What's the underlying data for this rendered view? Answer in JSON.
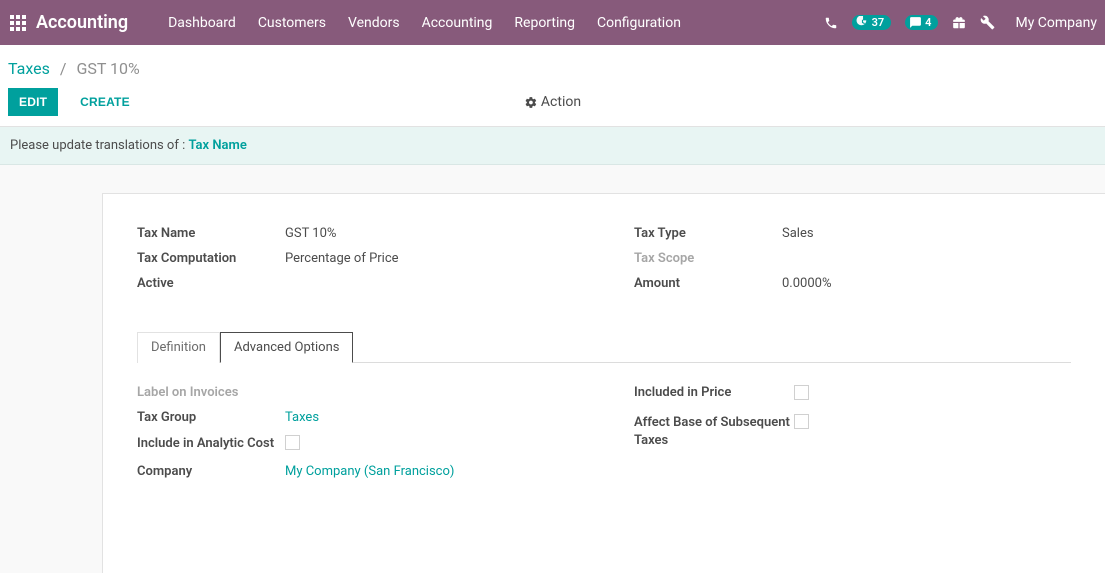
{
  "nav": {
    "brand": "Accounting",
    "menu": [
      "Dashboard",
      "Customers",
      "Vendors",
      "Accounting",
      "Reporting",
      "Configuration"
    ],
    "activities_count": "37",
    "discuss_count": "4",
    "company": "My Company"
  },
  "breadcrumb": {
    "parent": "Taxes",
    "current": "GST 10%"
  },
  "controls": {
    "edit": "EDIT",
    "create": "CREATE",
    "action": "Action"
  },
  "notice": {
    "text": "Please update translations of : ",
    "link": "Tax Name"
  },
  "form": {
    "left": {
      "tax_name_label": "Tax Name",
      "tax_name_value": "GST 10%",
      "tax_comp_label": "Tax Computation",
      "tax_comp_value": "Percentage of Price",
      "active_label": "Active"
    },
    "right": {
      "tax_type_label": "Tax Type",
      "tax_type_value": "Sales",
      "tax_scope_label": "Tax Scope",
      "amount_label": "Amount",
      "amount_value": "0.0000%"
    }
  },
  "tabs": {
    "definition": "Definition",
    "advanced": "Advanced Options"
  },
  "advanced": {
    "left": {
      "label_invoices": "Label on Invoices",
      "tax_group_label": "Tax Group",
      "tax_group_value": "Taxes",
      "include_analytic_label": "Include in Analytic Cost",
      "company_label": "Company",
      "company_value": "My Company (San Francisco)"
    },
    "right": {
      "included_price_label": "Included in Price",
      "affect_base_label": "Affect Base of Subsequent Taxes"
    }
  }
}
